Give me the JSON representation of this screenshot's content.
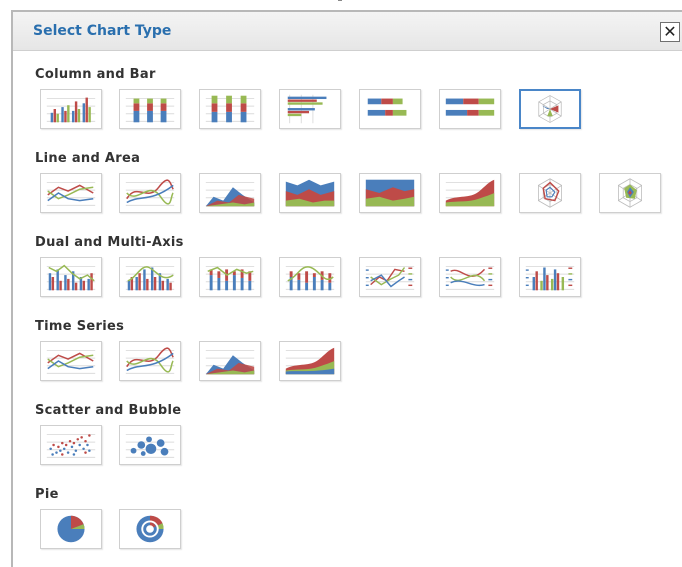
{
  "dialog": {
    "title": "Select Chart Type",
    "close_icon": "close-icon",
    "sections": [
      {
        "label": "Column and Bar",
        "items": [
          {
            "icon": "column-clustered-icon"
          },
          {
            "icon": "column-stacked-icon"
          },
          {
            "icon": "column-stacked-100-icon"
          },
          {
            "icon": "bar-clustered-icon"
          },
          {
            "icon": "bar-stacked-icon"
          },
          {
            "icon": "bar-stacked-100-icon"
          },
          {
            "icon": "radar-column-icon",
            "selected": true
          }
        ]
      },
      {
        "label": "Line and Area",
        "items": [
          {
            "icon": "line-icon"
          },
          {
            "icon": "spline-icon"
          },
          {
            "icon": "area-icon"
          },
          {
            "icon": "area-stacked-icon"
          },
          {
            "icon": "area-stacked-100-icon"
          },
          {
            "icon": "area-spline-icon"
          },
          {
            "icon": "radar-line-icon"
          },
          {
            "icon": "radar-area-icon"
          }
        ]
      },
      {
        "label": "Dual and Multi-Axis",
        "items": [
          {
            "icon": "column-line-icon"
          },
          {
            "icon": "column-spline-icon"
          },
          {
            "icon": "stacked-column-line-icon"
          },
          {
            "icon": "stacked-column-spline-icon"
          },
          {
            "icon": "multi-axis-line-icon"
          },
          {
            "icon": "multi-axis-spline-icon"
          },
          {
            "icon": "multi-axis-column-icon"
          }
        ]
      },
      {
        "label": "Time Series",
        "items": [
          {
            "icon": "timeseries-line-icon"
          },
          {
            "icon": "timeseries-spline-icon"
          },
          {
            "icon": "timeseries-area-icon"
          },
          {
            "icon": "timeseries-area-spline-icon"
          }
        ]
      },
      {
        "label": "Scatter and Bubble",
        "items": [
          {
            "icon": "scatter-icon"
          },
          {
            "icon": "bubble-icon"
          }
        ]
      },
      {
        "label": "Pie",
        "items": [
          {
            "icon": "pie-icon"
          },
          {
            "icon": "donut-icon"
          }
        ]
      }
    ]
  },
  "colors": {
    "title": "#2a6fae",
    "series_blue": "#4a7ebb",
    "series_red": "#be4b48",
    "series_green": "#98b954",
    "selected_border": "#4a86c8"
  }
}
